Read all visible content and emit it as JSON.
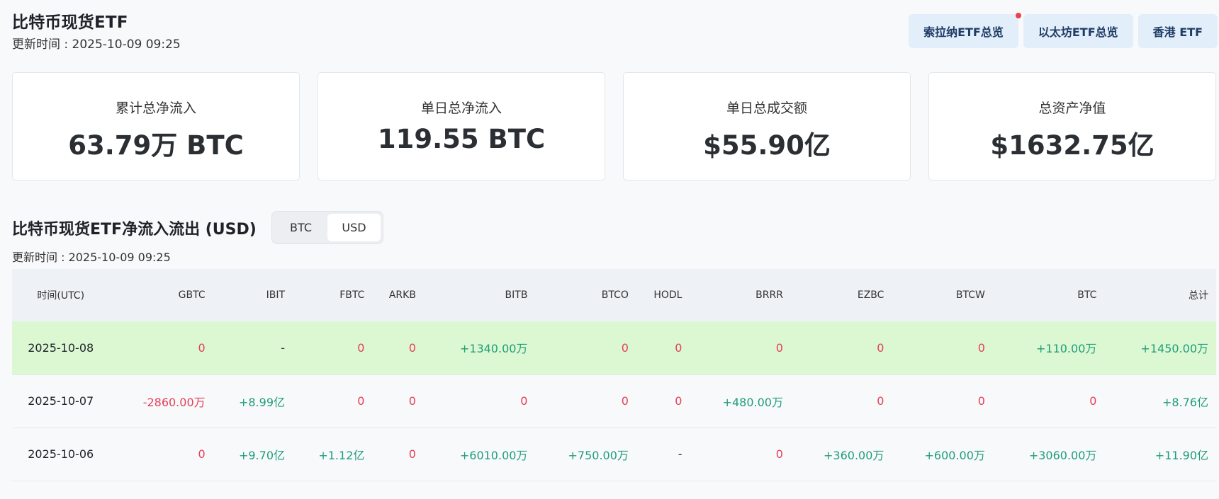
{
  "header": {
    "title": "比特币现货ETF",
    "updated": "更新时间 : 2025-10-09 09:25"
  },
  "nav": [
    {
      "label": "索拉纳ETF总览",
      "has_dot": true
    },
    {
      "label": "以太坊ETF总览",
      "has_dot": false
    },
    {
      "label": "香港 ETF",
      "has_dot": false
    }
  ],
  "stats": [
    {
      "label": "累计总净流入",
      "value": "63.79万 BTC"
    },
    {
      "label": "单日总净流入",
      "value": "119.55 BTC"
    },
    {
      "label": "单日总成交额",
      "value": "$55.90亿"
    },
    {
      "label": "总资产净值",
      "value": "$1632.75亿"
    }
  ],
  "flows": {
    "title": "比特币现货ETF净流入流出 (USD)",
    "toggle": {
      "options": [
        "BTC",
        "USD"
      ],
      "selected": "USD"
    },
    "updated": "更新时间 : 2025-10-09 09:25",
    "columns": [
      "时间(UTC)",
      "GBTC",
      "IBIT",
      "FBTC",
      "ARKB",
      "BITB",
      "BTCO",
      "HODL",
      "BRRR",
      "EZBC",
      "BTCW",
      "BTC",
      "总计"
    ],
    "rows": [
      {
        "highlight": true,
        "cells": [
          "2025-10-08",
          "0",
          "-",
          "0",
          "0",
          "+1340.00万",
          "0",
          "0",
          "0",
          "0",
          "0",
          "+110.00万",
          "+1450.00万"
        ]
      },
      {
        "highlight": false,
        "cells": [
          "2025-10-07",
          "-2860.00万",
          "+8.99亿",
          "0",
          "0",
          "0",
          "0",
          "0",
          "+480.00万",
          "0",
          "0",
          "0",
          "+8.76亿"
        ]
      },
      {
        "highlight": false,
        "cells": [
          "2025-10-06",
          "0",
          "+9.70亿",
          "+1.12亿",
          "0",
          "+6010.00万",
          "+750.00万",
          "-",
          "0",
          "+360.00万",
          "+600.00万",
          "+3060.00万",
          "+11.90亿"
        ]
      }
    ]
  },
  "colors": {
    "positive": "#1f9d78",
    "negative": "#e4405a",
    "highlight_row": "#dcf8d3",
    "nav_bg": "#e3eefb"
  }
}
